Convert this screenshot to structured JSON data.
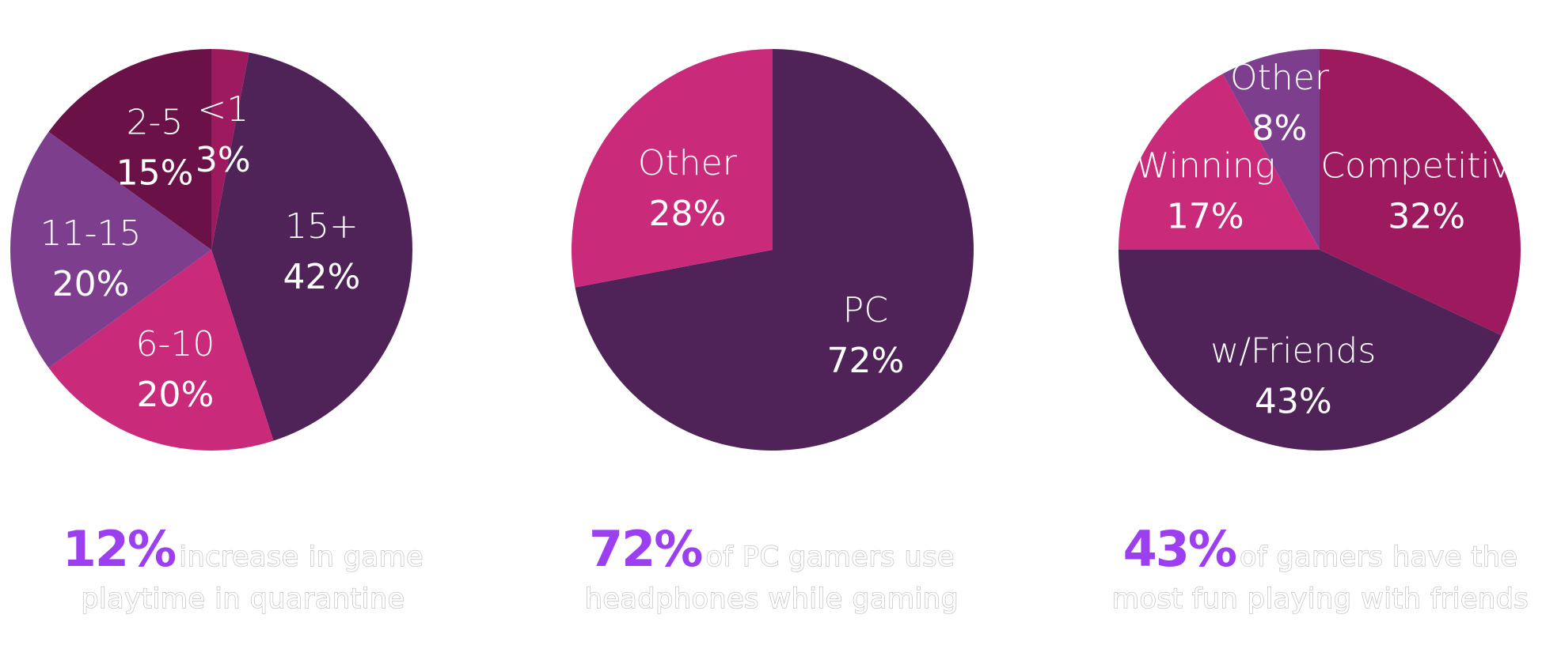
{
  "chart_data": [
    {
      "type": "pie",
      "title": "",
      "slices": [
        {
          "label": "<1",
          "percent_text": "3%",
          "value": 3,
          "color": "#9e1a5e"
        },
        {
          "label": "15+",
          "percent_text": "42%",
          "value": 42,
          "color": "#4f2358"
        },
        {
          "label": "6-10",
          "percent_text": "20%",
          "value": 20,
          "color": "#c92a7a"
        },
        {
          "label": "11-15",
          "percent_text": "20%",
          "value": 20,
          "color": "#7e3e8e"
        },
        {
          "label": "2-5",
          "percent_text": "15%",
          "value": 15,
          "color": "#6a1147"
        }
      ]
    },
    {
      "type": "pie",
      "title": "",
      "slices": [
        {
          "label": "PC",
          "percent_text": "72%",
          "value": 72,
          "color": "#4f2358"
        },
        {
          "label": "Other",
          "percent_text": "28%",
          "value": 28,
          "color": "#c92a7a"
        }
      ]
    },
    {
      "type": "pie",
      "title": "",
      "slices": [
        {
          "label": "Competitive",
          "percent_text": "32%",
          "value": 32,
          "color": "#9e1a5e"
        },
        {
          "label": "w/Friends",
          "percent_text": "43%",
          "value": 43,
          "color": "#4f2358"
        },
        {
          "label": "Winning",
          "percent_text": "17%",
          "value": 17,
          "color": "#c92a7a"
        },
        {
          "label": "Other",
          "percent_text": "8%",
          "value": 8,
          "color": "#7e3e8e"
        }
      ]
    }
  ],
  "captions": [
    {
      "stat": "12%",
      "line1": "increase in game",
      "line2": "playtime in quarantine"
    },
    {
      "stat": "72%",
      "line1": "of PC gamers use",
      "line2": "headphones while gaming"
    },
    {
      "stat": "43%",
      "line1": "of gamers have the",
      "line2": "most fun playing with friends"
    }
  ],
  "colors": {
    "stat_accent": "#9b3ff0",
    "label_text": "#ffffff"
  }
}
